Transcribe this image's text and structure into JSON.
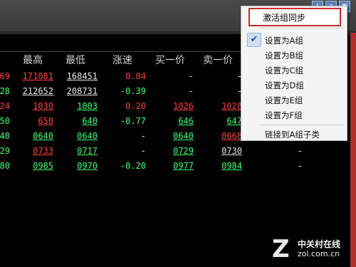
{
  "toolbar": {
    "btn1": "I",
    "btn2": "a",
    "btn3": "▣"
  },
  "headers": [
    "最高",
    "最低",
    "涨速",
    "买一价",
    "卖一价"
  ],
  "rows": [
    {
      "prefix": "69",
      "high": "171081",
      "low": "168451",
      "speed": "0.04",
      "bid": "-",
      "ask": "-"
    },
    {
      "prefix": "28",
      "high": "212652",
      "low": "208731",
      "speed": "-0.39",
      "bid": "-",
      "ask": "-"
    },
    {
      "prefix": "24",
      "high": "1030",
      "low": "1003",
      "speed": "0.20",
      "bid": "1026",
      "ask": "1028"
    },
    {
      "prefix": "50",
      "high": "650",
      "low": "640",
      "speed": "-0.77",
      "bid": "646",
      "ask": "647"
    },
    {
      "prefix": "40",
      "high": "0640",
      "low": "0640",
      "speed": "-",
      "bid": "0640",
      "ask": "0668"
    },
    {
      "prefix": "29",
      "high": "0733",
      "low": "0717",
      "speed": "-",
      "bid": "0729",
      "ask": "0730"
    },
    {
      "prefix": "80",
      "high": "0985",
      "low": "0970",
      "speed": "-0.20",
      "bid": "0977",
      "ask": "0984"
    }
  ],
  "extra_dashes": [
    "-",
    "-"
  ],
  "menu": {
    "top": "激活组同步",
    "items": [
      "设置为A组",
      "设置为B组",
      "设置为C组",
      "设置为D组",
      "设置为E组",
      "设置为F组"
    ],
    "link": "链接到A组子类",
    "checked_index": 0
  },
  "logo": {
    "letter": "Z",
    "name": "中关村在线",
    "url": "zol.com.cn"
  }
}
